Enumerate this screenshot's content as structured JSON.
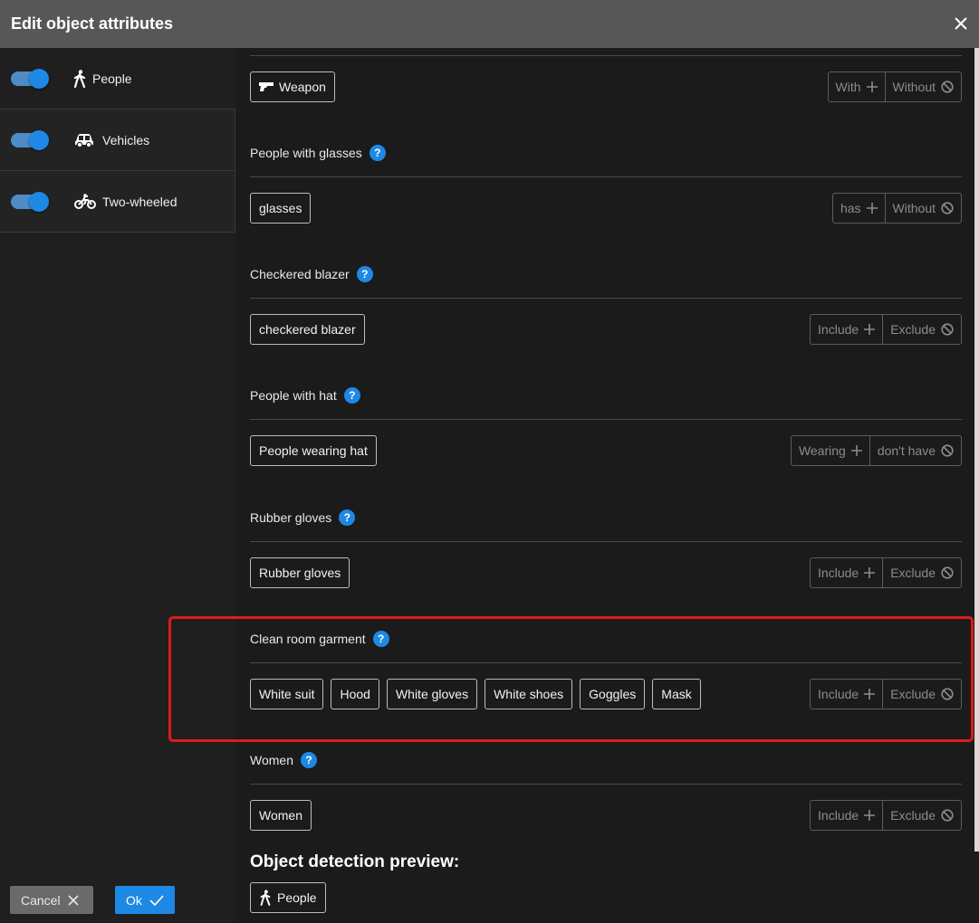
{
  "dialog": {
    "title": "Edit object attributes"
  },
  "sidebar": {
    "items": [
      {
        "label": "People",
        "enabled": true,
        "icon": "walking-person-icon"
      },
      {
        "label": "Vehicles",
        "enabled": true,
        "icon": "car-icon"
      },
      {
        "label": "Two-wheeled",
        "enabled": true,
        "icon": "motorcycle-icon"
      }
    ]
  },
  "sections": [
    {
      "title": "",
      "chips": [
        "Weapon"
      ],
      "chip_icon": "pistol-icon",
      "include_label": "With",
      "exclude_label": "Without"
    },
    {
      "title": "People with glasses",
      "chips": [
        "glasses"
      ],
      "include_label": "has",
      "exclude_label": "Without"
    },
    {
      "title": "Checkered blazer",
      "chips": [
        "checkered blazer"
      ],
      "include_label": "Include",
      "exclude_label": "Exclude"
    },
    {
      "title": "People with hat",
      "chips": [
        "People wearing hat"
      ],
      "include_label": "Wearing",
      "exclude_label": "don't have"
    },
    {
      "title": "Rubber gloves",
      "chips": [
        "Rubber gloves"
      ],
      "include_label": "Include",
      "exclude_label": "Exclude"
    },
    {
      "title": "Clean room garment",
      "chips": [
        "White suit",
        "Hood",
        "White gloves",
        "White shoes",
        "Goggles",
        "Mask"
      ],
      "include_label": "Include",
      "exclude_label": "Exclude"
    },
    {
      "title": "Women",
      "chips": [
        "Women"
      ],
      "include_label": "Include",
      "exclude_label": "Exclude"
    }
  ],
  "help_glyph": "?",
  "preview": {
    "title": "Object detection preview:",
    "chip": "People"
  },
  "footer": {
    "cancel_label": "Cancel",
    "ok_label": "Ok"
  },
  "colors": {
    "accent": "#1e88e5",
    "highlight": "#e01b1b"
  }
}
